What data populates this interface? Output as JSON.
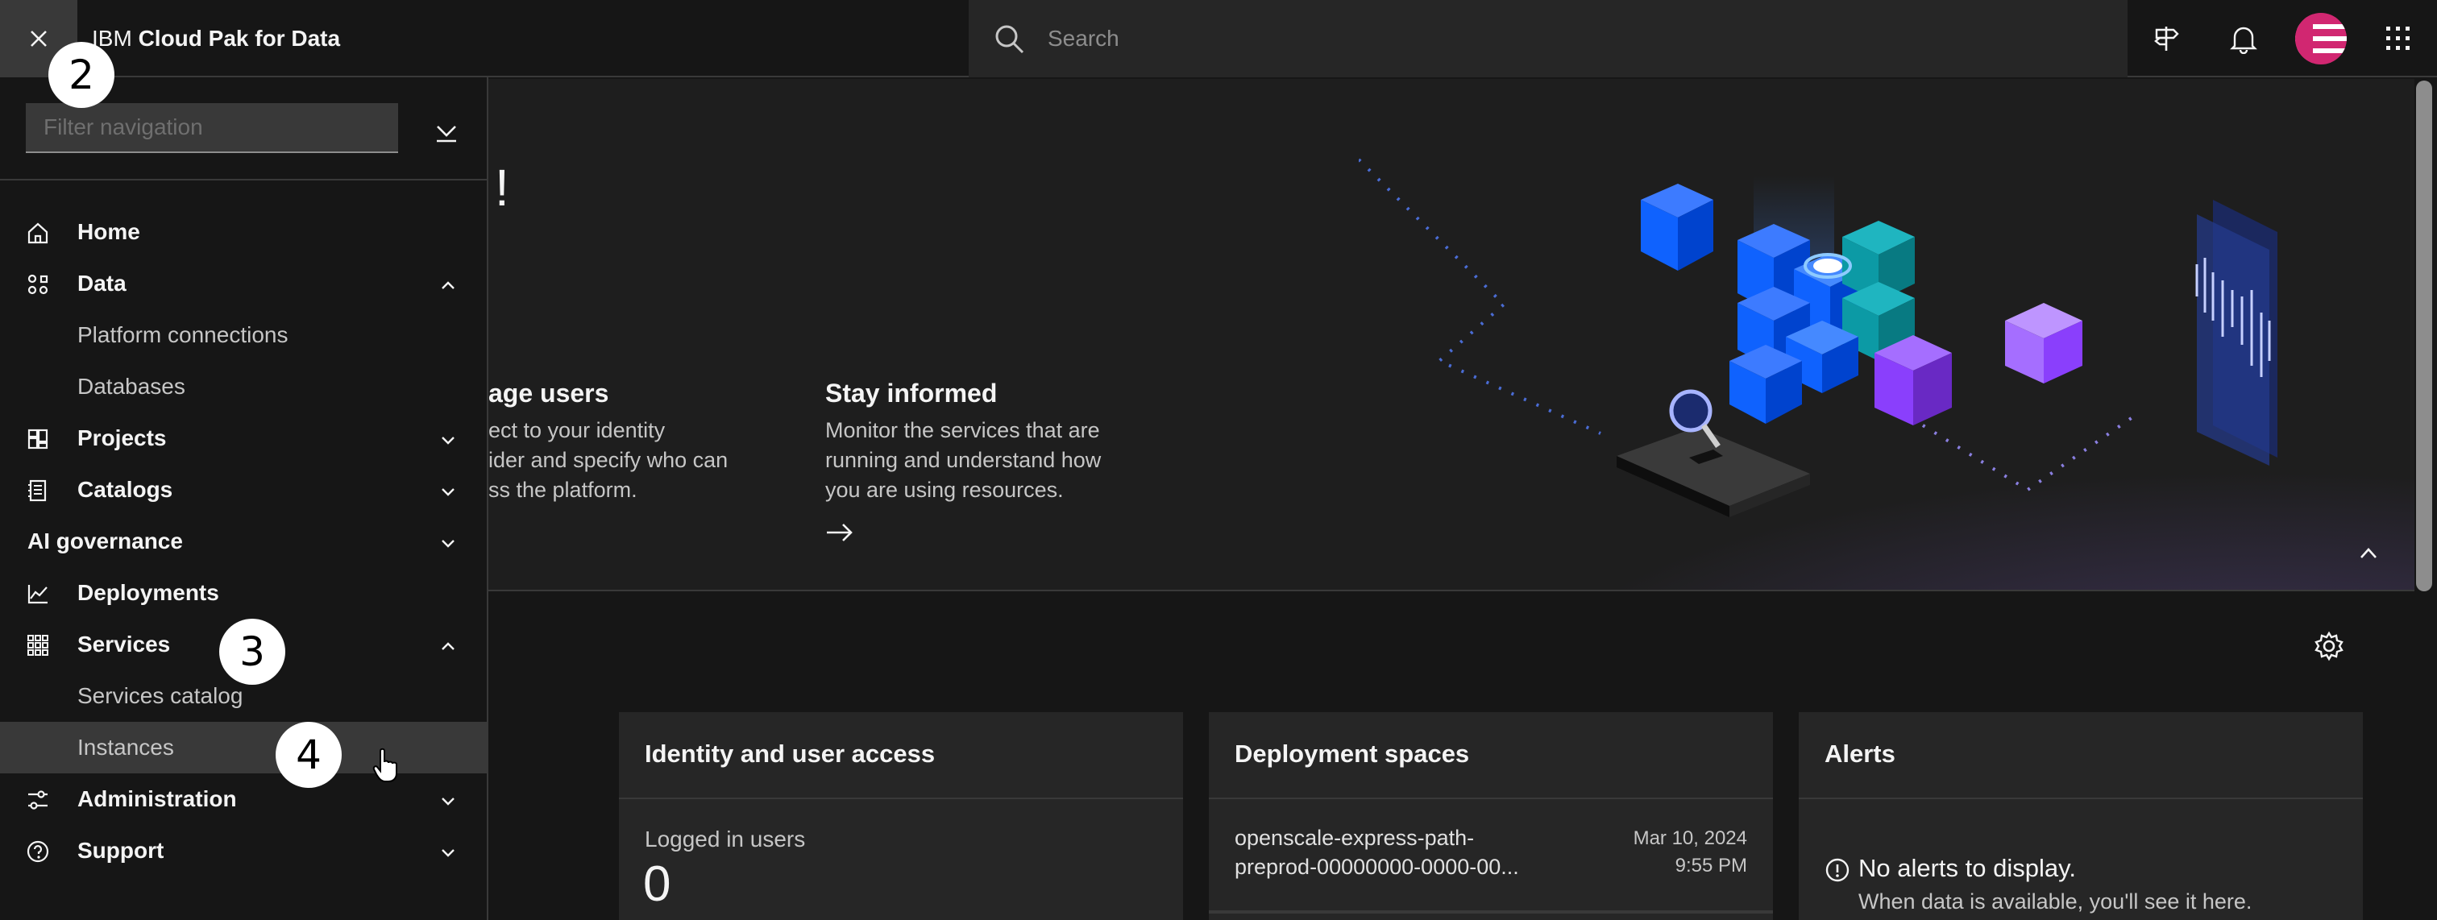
{
  "header": {
    "app_title_prefix": "IBM",
    "app_title_bold": "Cloud Pak for Data",
    "search_placeholder": "Search"
  },
  "sidenav": {
    "filter_placeholder": "Filter navigation",
    "items": [
      {
        "label": "Home"
      },
      {
        "label": "Data"
      },
      {
        "label": "Platform connections"
      },
      {
        "label": "Databases"
      },
      {
        "label": "Projects"
      },
      {
        "label": "Catalogs"
      },
      {
        "label": "AI governance"
      },
      {
        "label": "Deployments"
      },
      {
        "label": "Services"
      },
      {
        "label": "Services catalog"
      },
      {
        "label": "Instances"
      },
      {
        "label": "Administration"
      },
      {
        "label": "Support"
      }
    ]
  },
  "hero": {
    "heading_tail": "!",
    "cards": [
      {
        "title": "age users",
        "text": "ect to your identity\nider and specify who can\nss the platform."
      },
      {
        "title": "Stay informed",
        "text": "Monitor the services that are\nrunning and understand how\nyou are using resources."
      }
    ]
  },
  "dashboard": {
    "identity_card": {
      "title": "Identity and user access",
      "metric_label": "Logged in users",
      "metric_value": "0"
    },
    "deployment_card": {
      "title": "Deployment spaces",
      "space_name": "openscale-express-path-\npreprod-00000000-0000-00...",
      "space_date": "Mar 10, 2024\n9:55 PM"
    },
    "alerts_card": {
      "title": "Alerts",
      "empty_title": "No alerts to display.",
      "empty_text": "When data is available, you'll see it here."
    }
  },
  "markers": [
    "2",
    "3",
    "4"
  ],
  "colors": {
    "background": "#161616",
    "panel": "#262626",
    "active_item": "#393939",
    "avatar": "#d12771",
    "accent_blue": "#0f62fe"
  }
}
